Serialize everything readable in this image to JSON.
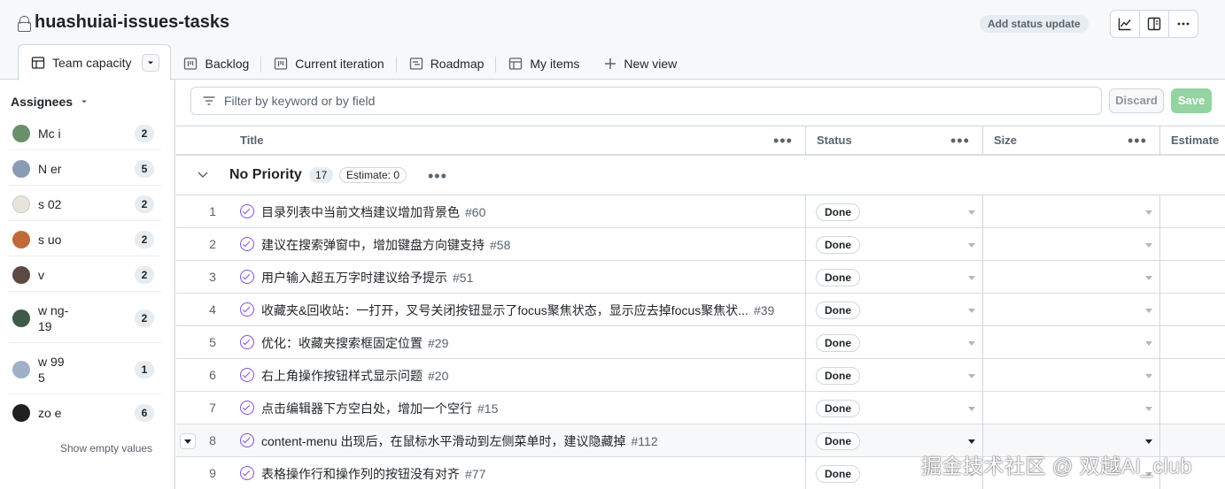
{
  "project": {
    "title": "huashuiai-issues-tasks",
    "status_button": "Add status update"
  },
  "toolbar_icons": [
    "insights-icon",
    "side-panel-icon",
    "more-icon"
  ],
  "tabs": [
    {
      "label": "Team capacity",
      "icon": "table-icon",
      "active": true
    },
    {
      "label": "Backlog",
      "icon": "board-icon"
    },
    {
      "label": "Current iteration",
      "icon": "board-icon"
    },
    {
      "label": "Roadmap",
      "icon": "roadmap-icon"
    },
    {
      "label": "My items",
      "icon": "table-icon"
    },
    {
      "label": "New view",
      "icon": "plus-icon"
    }
  ],
  "sidebar": {
    "heading": "Assignees",
    "assignees": [
      {
        "name": "Mc       i",
        "count": "2",
        "color": "#6a8f6b"
      },
      {
        "name": "N         er",
        "count": "5",
        "color": "#8a9bb5"
      },
      {
        "name": "s         02",
        "count": "2",
        "color": "#e9e4de"
      },
      {
        "name": "s         uo",
        "count": "2",
        "color": "#c06a3a"
      },
      {
        "name": "v",
        "count": "2",
        "color": "#5b4a44"
      },
      {
        "name": "w       ng-\n19",
        "count": "2",
        "color": "#3d5a4a"
      },
      {
        "name": "w        99\n5",
        "count": "1",
        "color": "#9fb0c8"
      },
      {
        "name": "zo        e",
        "count": "6",
        "color": "#1f1f1f"
      }
    ],
    "show_empty": "Show empty values"
  },
  "filter": {
    "placeholder": "Filter by keyword or by field",
    "discard": "Discard",
    "save": "Save"
  },
  "table": {
    "columns": [
      "Title",
      "Status",
      "Size",
      "Estimate"
    ],
    "group": {
      "title": "No Priority",
      "count": "17",
      "estimate": "Estimate: 0"
    },
    "rows": [
      {
        "n": "1",
        "title": "目录列表中当前文档建议增加背景色",
        "num": "#60",
        "status": "Done"
      },
      {
        "n": "2",
        "title": "建议在搜索弹窗中，增加键盘方向键支持",
        "num": "#58",
        "status": "Done"
      },
      {
        "n": "3",
        "title": "用户输入超五万字时建议给予提示",
        "num": "#51",
        "status": "Done"
      },
      {
        "n": "4",
        "title": "收藏夹&回收站：一打开，叉号关闭按钮显示了focus聚焦状态，显示应去掉focus聚焦状...",
        "num": "#39",
        "status": "Done"
      },
      {
        "n": "5",
        "title": "优化：收藏夹搜索框固定位置",
        "num": "#29",
        "status": "Done"
      },
      {
        "n": "6",
        "title": "右上角操作按钮样式显示问题",
        "num": "#20",
        "status": "Done"
      },
      {
        "n": "7",
        "title": "点击编辑器下方空白处，增加一个空行",
        "num": "#15",
        "status": "Done"
      },
      {
        "n": "8",
        "title": "content-menu 出现后，在鼠标水平滑动到左侧菜单时，建议隐藏掉",
        "num": "#112",
        "status": "Done"
      },
      {
        "n": "9",
        "title": "表格操作行和操作列的按钮没有对齐",
        "num": "#77",
        "status": "Done"
      }
    ]
  },
  "watermark": "掘金技术社区 @ 双越AI_club"
}
